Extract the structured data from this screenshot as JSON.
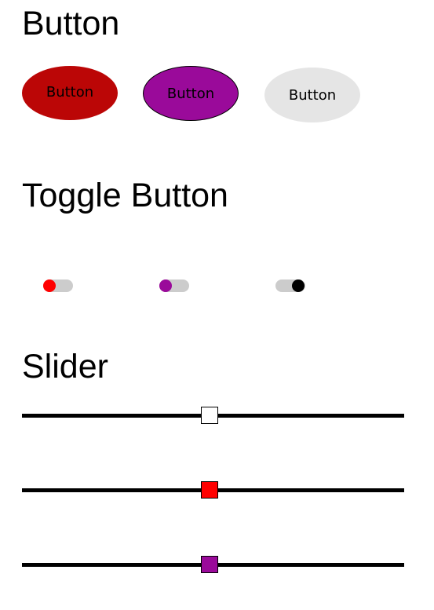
{
  "sections": {
    "button_heading": "Button",
    "toggle_heading": "Toggle Button",
    "slider_heading": "Slider"
  },
  "buttons": [
    {
      "label": "Button",
      "color": "#bb0606"
    },
    {
      "label": "Button",
      "color": "#9a0a9a"
    },
    {
      "label": "Button",
      "color": "#e5e5e5"
    }
  ],
  "toggles": [
    {
      "state": "off",
      "knob_color": "#ff0000",
      "track_color": "#cccccc"
    },
    {
      "state": "off",
      "knob_color": "#9a0a9a",
      "track_color": "#cccccc"
    },
    {
      "state": "on",
      "knob_color": "#000000",
      "track_color": "#cccccc"
    }
  ],
  "sliders": [
    {
      "value": 0.5,
      "thumb_color": "#ffffff"
    },
    {
      "value": 0.5,
      "thumb_color": "#ff0000"
    },
    {
      "value": 0.5,
      "thumb_color": "#9a0a9a"
    }
  ]
}
